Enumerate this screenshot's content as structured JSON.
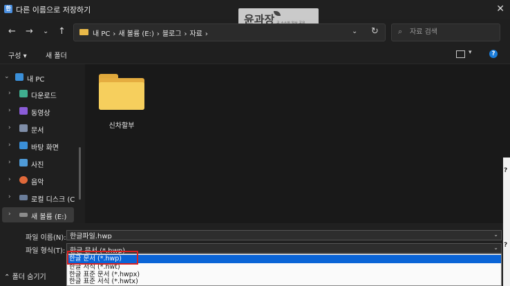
{
  "window": {
    "title": "다른 이름으로 저장하기",
    "close": "✕",
    "app_icon_glyph": "한"
  },
  "watermark": {
    "text": "윤과장",
    "subtext": "공 소소한 일상 공유"
  },
  "nav": {
    "breadcrumbs": [
      "내 PC",
      "›",
      "새 볼륨 (E:)",
      "›",
      "블로그",
      "›",
      "자료",
      "›"
    ],
    "search_placeholder": "자료 검색"
  },
  "toolbar": {
    "organize": "구성 ▾",
    "new_folder": "새 폴더"
  },
  "sidebar": {
    "items": [
      {
        "label": "내 PC",
        "icon": "pc-icon",
        "color": "#3a8fd8",
        "expanded": true
      },
      {
        "label": "다운로드",
        "icon": "download-icon",
        "color": "#3fae8f"
      },
      {
        "label": "동영상",
        "icon": "video-icon",
        "color": "#8a5cd8"
      },
      {
        "label": "문서",
        "icon": "document-icon",
        "color": "#7f8ea8"
      },
      {
        "label": "바탕 화면",
        "icon": "desktop-icon",
        "color": "#3a8fd8"
      },
      {
        "label": "사진",
        "icon": "picture-icon",
        "color": "#4f9bd8"
      },
      {
        "label": "음악",
        "icon": "music-icon",
        "color": "#e0693a"
      },
      {
        "label": "로컬 디스크 (C",
        "icon": "drive-icon",
        "color": "#6a7d9a"
      },
      {
        "label": "새 볼륨 (E:)",
        "icon": "drive-icon",
        "color": "#8c8c8c",
        "selected": true
      }
    ]
  },
  "content": {
    "folders": [
      {
        "name": "신차할부"
      }
    ]
  },
  "form": {
    "filename_label": "파일 이름(N):",
    "filename_value": "한글파일.hwp",
    "filetype_label": "파일 형식(T):",
    "filetype_value": "한글 문서 (*.hwp)",
    "filetype_options": [
      "한글 문서 (*.hwp)",
      "한글 서식 (*.hwt)",
      "한글 표준 문서 (*.hwpx)",
      "한글 표준 서식 (*.hwtx)"
    ],
    "selected_option_index": 0,
    "hide_folders": "폴더 숨기기"
  },
  "right_strip": {
    "glyphs": [
      "?",
      "?"
    ]
  },
  "colors": {
    "accent": "#0a64d6",
    "highlight_border": "#d72020",
    "folder": "#f6cf5d"
  }
}
